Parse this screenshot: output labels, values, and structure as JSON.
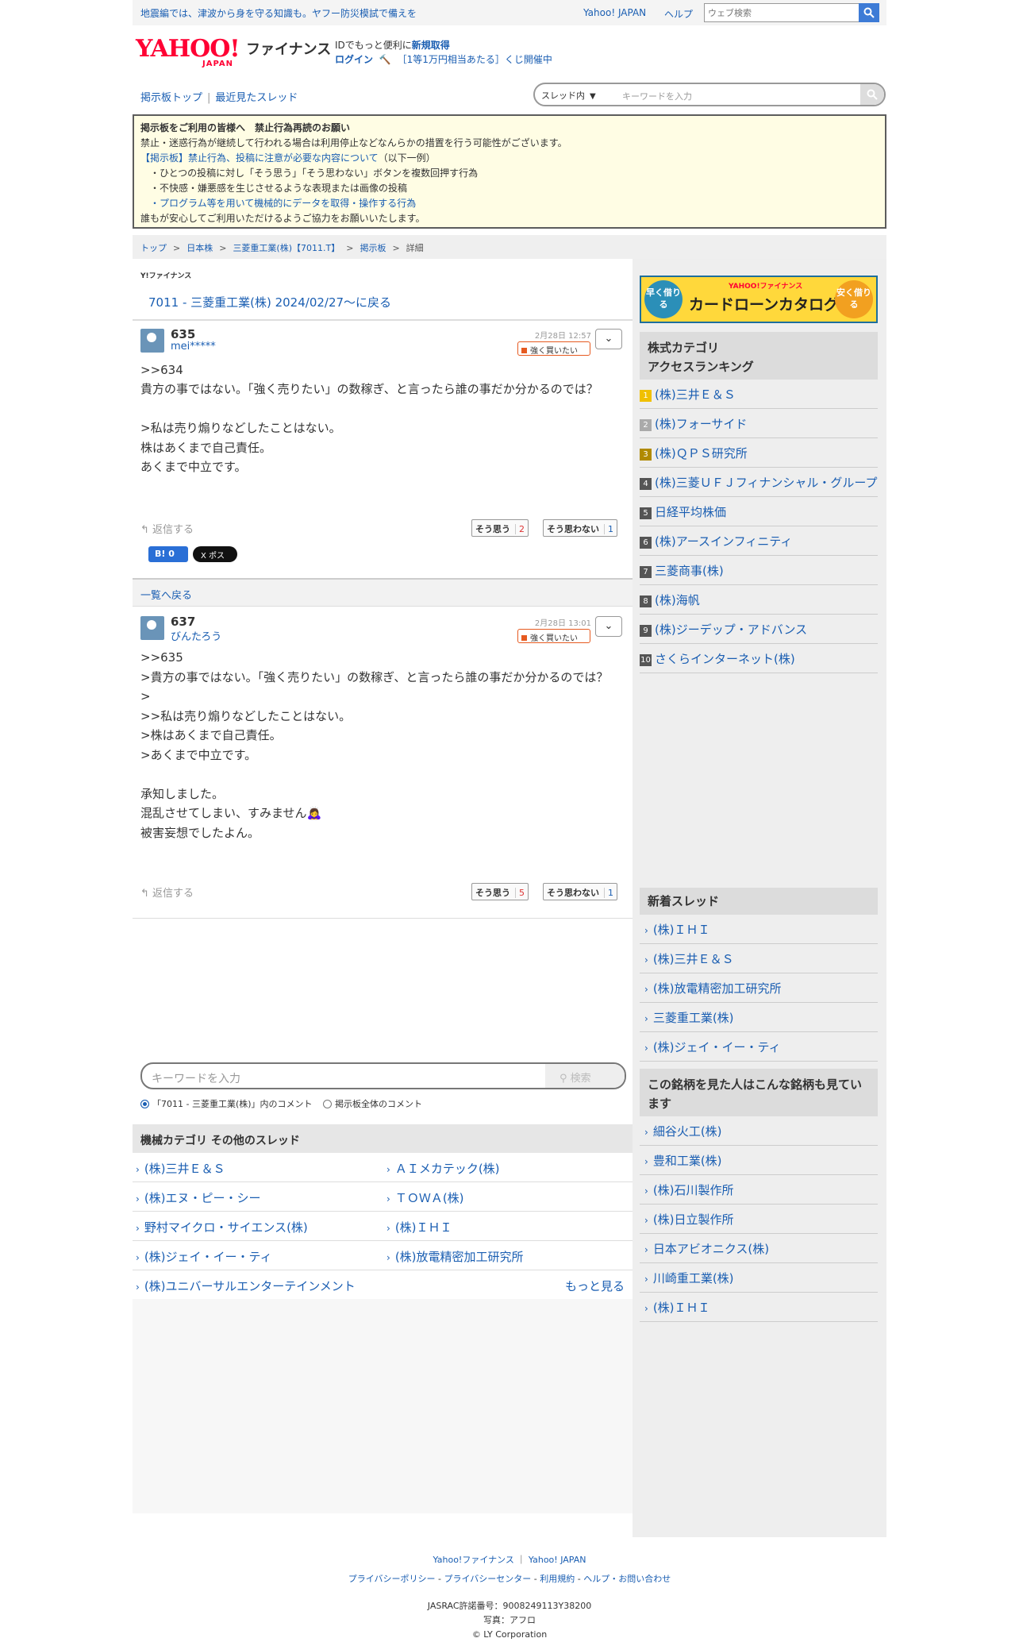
{
  "topbar": {
    "promo": "地震編では、津波から身を守る知識も。ヤフー防災模試で備えを",
    "links": [
      "Yahoo! JAPAN",
      "ヘルプ"
    ],
    "search_placeholder": "ウェブ検索"
  },
  "header": {
    "logo_text": "YAHOO!",
    "logo_sub": "JAPAN",
    "site_title": "ファイナンス",
    "id_line_prefix": "IDでもっと便利に",
    "id_line_link": "新規取得",
    "login": "ログイン",
    "lottery": "［1等1万円相当あたる］くじ開催中"
  },
  "nav": {
    "items": [
      "掲示板トップ",
      "最近見たスレッド"
    ],
    "scope": "スレッド内",
    "keyword_placeholder": "キーワードを入力"
  },
  "notice": {
    "title": "掲示板をご利用の皆様へ　禁止行為再読のお願い",
    "line1": "禁止・迷惑行為が継続して行われる場合は利用停止などなんらかの措置を行う可能性がございます。",
    "link": "【掲示板】禁止行為、投稿に注意が必要な内容について",
    "link_suffix": "（以下一例）",
    "bullets": [
      "・ひとつの投稿に対し「そう思う」「そう思わない」ボタンを複数回押す行為",
      "・不快感・嫌悪感を生じさせるような表現または画像の投稿",
      "・プログラム等を用いて機械的にデータを取得・操作する行為"
    ],
    "footer_line": "誰もが安心してご利用いただけるようご協力をお願いいたします。"
  },
  "breadcrumb": [
    "トップ",
    "日本株",
    "三菱重工業(株)【7011.T】",
    "掲示板",
    "詳細"
  ],
  "thread": {
    "brand_mini": "Y!ファイナンス",
    "back_title": "7011 - 三菱重工業(株) 2024/02/27〜に戻る",
    "list_back": "一覧へ戻る"
  },
  "posts": [
    {
      "num": "635",
      "name": "mei*****",
      "date": "2月28日 12:57",
      "sentiment": "強く買いたい",
      "reply_link": ">>634",
      "body": "貴方の事ではない。「強く売りたい」の数稼ぎ、と言ったら誰の事だか分かるのでは？\n\n>私は売り煽りなどしたことはない。\n株はあくまで自己責任。\nあくまで中立です。",
      "reply_label": "返信する",
      "agree_label": "そう思う",
      "agree_count": "2",
      "disagree_label": "そう思わない",
      "disagree_count": "1",
      "hatena": "B! 0",
      "x_share": "X ポスト"
    },
    {
      "num": "637",
      "name": "びんたろう",
      "date": "2月28日 13:01",
      "sentiment": "強く買いたい",
      "body": ">>635\n>貴方の事ではない。「強く売りたい」の数稼ぎ、と言ったら誰の事だか分かるのでは？\n>\n>>私は売り煽りなどしたことはない。\n>株はあくまで自己責任。\n>あくまで中立です。\n\n承知しました。\n混乱させてしまい、すみません🙇‍♀️\n被害妄想でしたよん。",
      "reply_label": "返信する",
      "agree_label": "そう思う",
      "agree_count": "5",
      "disagree_label": "そう思わない",
      "disagree_count": "1"
    }
  ],
  "bottom_search": {
    "placeholder": "キーワードを入力",
    "button": "検索",
    "radio_thread": "「7011 - 三菱重工業(株)」内のコメント",
    "radio_all": "掲示板全体のコメント"
  },
  "category": {
    "title": "機械カテゴリ その他のスレッド",
    "items": [
      "(株)三井Ｅ＆Ｓ",
      "ＡＩメカテック(株)",
      "(株)エヌ・ピー・シー",
      "ＴＯＷＡ(株)",
      "野村マイクロ・サイエンス(株)",
      "(株)ＩＨＩ",
      "(株)ジェイ・イー・ティ",
      "(株)放電精密加工研究所",
      "(株)ユニバーサルエンターテインメント"
    ],
    "more": "もっと見る"
  },
  "sidebar": {
    "ad": {
      "left_badge": "早く借りる",
      "right_badge": "安く借りる",
      "brand": "YAHOO!ファイナンス",
      "title": "カードローンカタログ"
    },
    "ranking_title_1": "株式カテゴリ",
    "ranking_title_2": "アクセスランキング",
    "ranking": [
      {
        "rank": "1",
        "name": "(株)三井Ｅ＆Ｓ",
        "color": "#f0c000"
      },
      {
        "rank": "2",
        "name": "(株)フォーサイド",
        "color": "#aaaaaa"
      },
      {
        "rank": "3",
        "name": "(株)ＱＰＳ研究所",
        "color": "#b08a00"
      },
      {
        "rank": "4",
        "name": "(株)三菱ＵＦＪフィナンシャル・グループ",
        "color": "#555555"
      },
      {
        "rank": "5",
        "name": "日経平均株価",
        "color": "#555555"
      },
      {
        "rank": "6",
        "name": "(株)アースインフィニティ",
        "color": "#555555"
      },
      {
        "rank": "7",
        "name": "三菱商事(株)",
        "color": "#555555"
      },
      {
        "rank": "8",
        "name": "(株)海帆",
        "color": "#555555"
      },
      {
        "rank": "9",
        "name": "(株)ジーデップ・アドバンス",
        "color": "#555555"
      },
      {
        "rank": "10",
        "name": "さくらインターネット(株)",
        "color": "#555555"
      }
    ],
    "new_threads_title": "新着スレッド",
    "new_threads": [
      "(株)ＩＨＩ",
      "(株)三井Ｅ＆Ｓ",
      "(株)放電精密加工研究所",
      "三菱重工業(株)",
      "(株)ジェイ・イー・ティ"
    ],
    "also_viewed_title": "この銘柄を見た人はこんな銘柄も見ています",
    "also_viewed": [
      "細谷火工(株)",
      "豊和工業(株)",
      "(株)石川製作所",
      "(株)日立製作所",
      "日本アビオニクス(株)",
      "川崎重工業(株)",
      "(株)ＩＨＩ"
    ]
  },
  "footer": {
    "links1": [
      "Yahoo!ファイナンス",
      "Yahoo! JAPAN"
    ],
    "links2": [
      "プライバシーポリシー",
      "プライバシーセンター",
      "利用規約",
      "ヘルプ・お問い合わせ"
    ],
    "jasrac": "JASRAC許諾番号：9008249113Y38200",
    "photo": "写真：アフロ",
    "copyright": "© LY Corporation"
  }
}
